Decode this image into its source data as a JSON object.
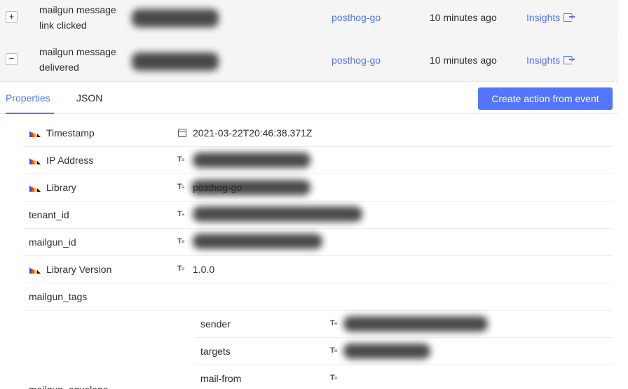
{
  "events": [
    {
      "expander": "+",
      "name": "mailgun message link clicked",
      "library": "posthog-go",
      "time": "10 minutes ago",
      "insights": "Insights"
    },
    {
      "expander": "−",
      "name": "mailgun message delivered",
      "library": "posthog-go",
      "time": "10 minutes ago",
      "insights": "Insights"
    }
  ],
  "tabs": {
    "properties": "Properties",
    "json": "JSON"
  },
  "create_action_button": "Create action from event",
  "properties": [
    {
      "key": "Timestamp",
      "value": "2021-03-22T20:46:38.371Z"
    },
    {
      "key": "IP Address",
      "value": ""
    },
    {
      "key": "Library",
      "value": "posthog-go"
    },
    {
      "key": "tenant_id",
      "value": ""
    },
    {
      "key": "mailgun_id",
      "value": ""
    },
    {
      "key": "Library Version",
      "value": "1.0.0"
    },
    {
      "key": "mailgun_tags",
      "value": ""
    }
  ],
  "nested": [
    {
      "key": "sender"
    },
    {
      "key": "targets"
    },
    {
      "key": "mail-from"
    }
  ],
  "nested_parent_key": "mailgun_envelope",
  "type_icon_text": "T",
  "colors": {
    "accent": "#5375ff",
    "row_bg": "#f5f5f5"
  }
}
